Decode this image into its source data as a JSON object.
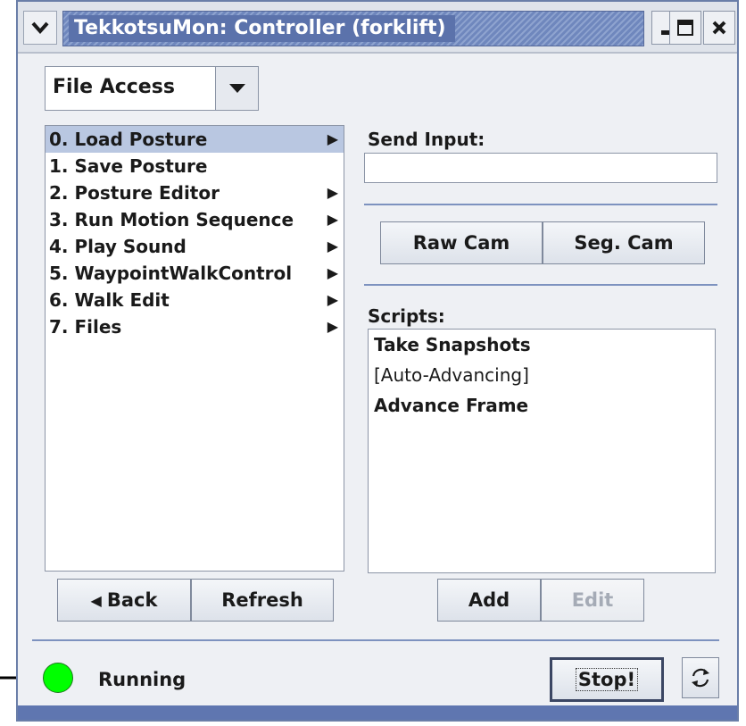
{
  "window": {
    "title": "TekkotsuMon: Controller (forklift)"
  },
  "combo": {
    "selected": "File Access"
  },
  "menu_items": [
    {
      "label": "0. Load Posture",
      "submenu": true,
      "selected": true
    },
    {
      "label": "1. Save Posture",
      "submenu": false
    },
    {
      "label": "2. Posture Editor",
      "submenu": true
    },
    {
      "label": "3. Run Motion Sequence",
      "submenu": true
    },
    {
      "label": "4. Play Sound",
      "submenu": true
    },
    {
      "label": "5. WaypointWalkControl",
      "submenu": true
    },
    {
      "label": "6. Walk Edit",
      "submenu": true
    },
    {
      "label": "7. Files",
      "submenu": true
    }
  ],
  "send_input": {
    "label": "Send Input:",
    "value": ""
  },
  "cam_buttons": {
    "raw": "Raw Cam",
    "seg": "Seg. Cam"
  },
  "scripts": {
    "label": "Scripts:",
    "items": [
      "Take Snapshots",
      "[Auto-Advancing]",
      "Advance Frame"
    ]
  },
  "nav_buttons": {
    "back": "Back",
    "refresh": "Refresh"
  },
  "script_buttons": {
    "add": "Add",
    "edit": "Edit"
  },
  "status": {
    "text": "Running",
    "color": "#00ff00"
  },
  "stop_button": "Stop!",
  "colors": {
    "accent": "#5b72ab",
    "selection": "#b9c7e1",
    "separator": "#7d92bf"
  }
}
